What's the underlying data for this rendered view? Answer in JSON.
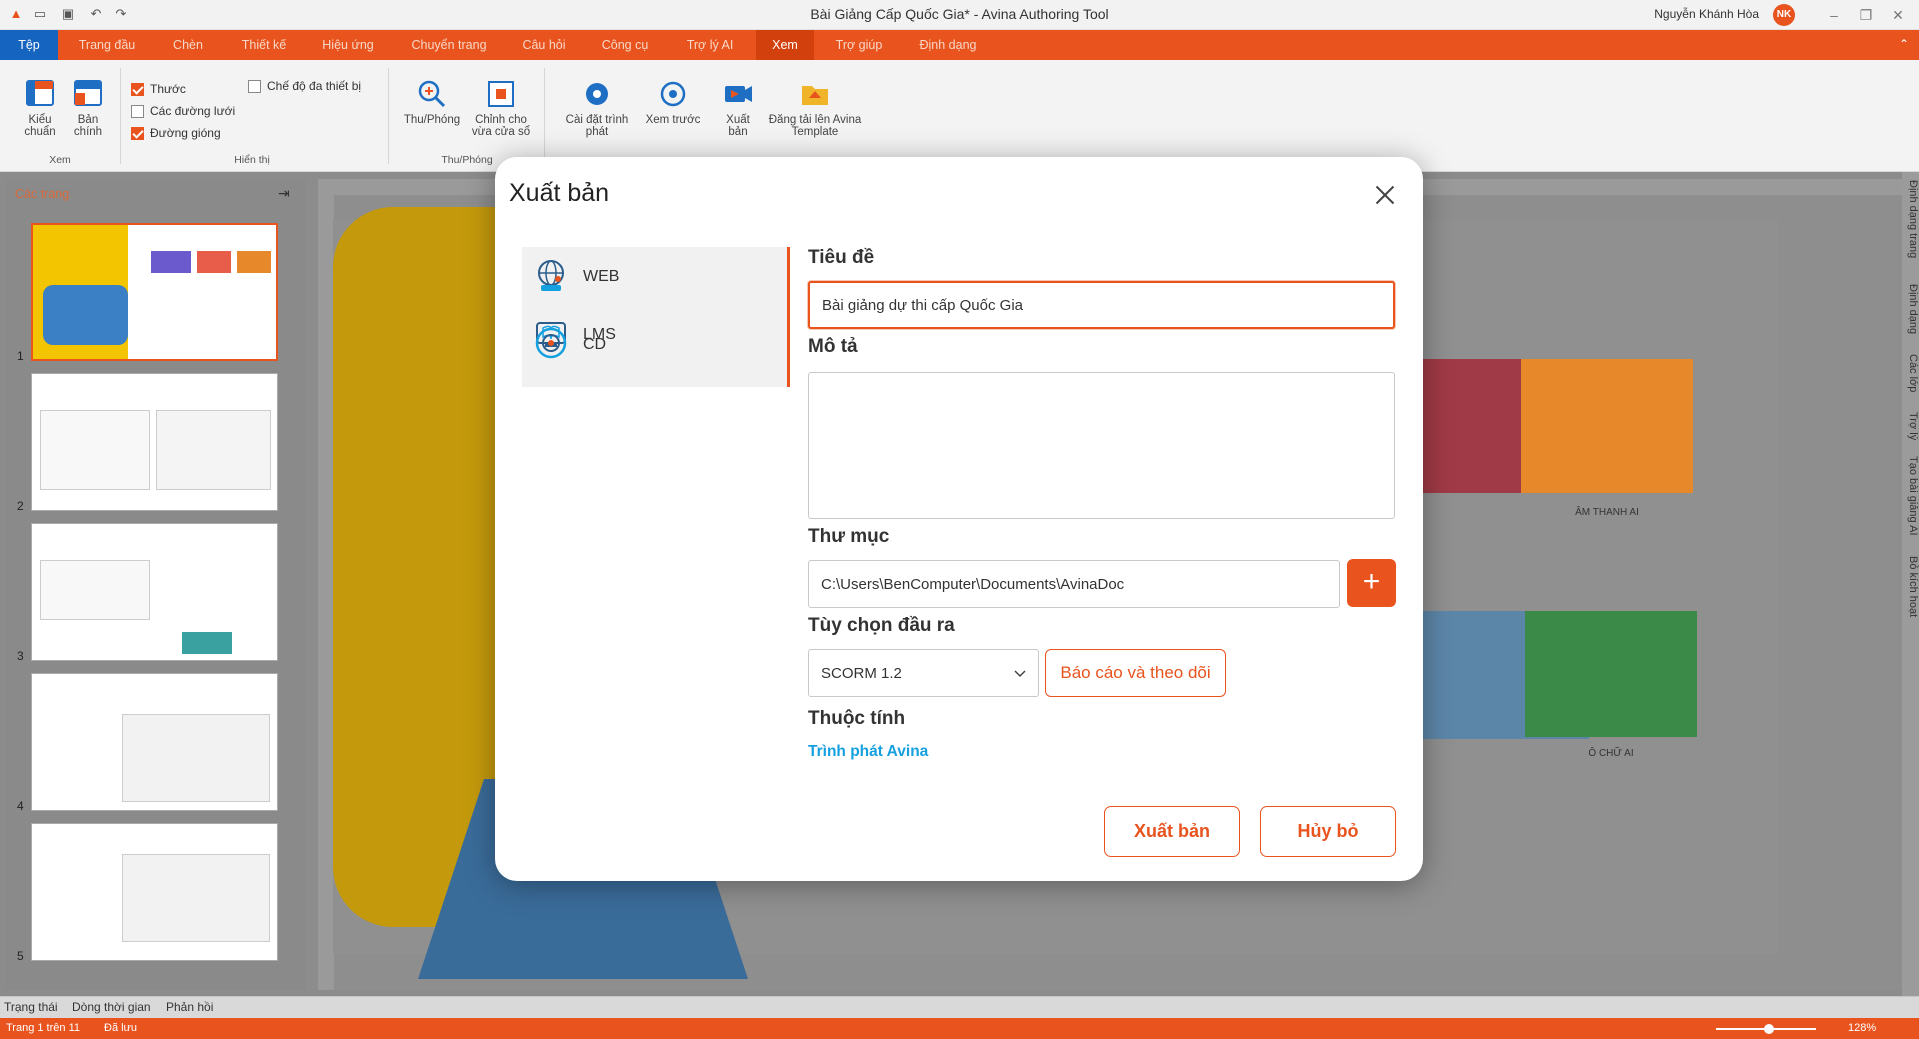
{
  "window": {
    "title": "Bài Giảng Cấp Quốc Gia* - Avina Authoring Tool",
    "user_name": "Nguyễn Khánh Hòa",
    "user_initials": "NK"
  },
  "menu": {
    "items": [
      "Tệp",
      "Trang đầu",
      "Chèn",
      "Thiết kế",
      "Hiệu ứng",
      "Chuyển trang",
      "Câu hỏi",
      "Công cụ",
      "Trợ lý AI",
      "Xem",
      "Trợ giúp",
      "Định dạng"
    ],
    "active": "Xem"
  },
  "ribbon": {
    "view_group": {
      "normal": "Kiểu chuẩn",
      "master": "Bản chính",
      "label": "Xem"
    },
    "show_group": {
      "ruler": "Thước",
      "grid": "Các đường lưới",
      "guides": "Đường gióng",
      "multi_device": "Chế độ đa thiết bị",
      "label": "Hiển thị",
      "ruler_checked": true,
      "grid_checked": false,
      "guides_checked": true,
      "multi_device_checked": false
    },
    "zoom_group": {
      "zoom": "Thu/Phóng",
      "fit": "Chỉnh cho vừa cửa sổ",
      "label": "Thu/Phóng"
    },
    "player_settings": "Cài đặt trình phát",
    "preview": "Xem trước",
    "publish": "Xuất bản",
    "upload_template": "Đăng tải lên Avina Template"
  },
  "pages_panel": {
    "title": "Các trang",
    "numbers": [
      "1",
      "2",
      "3",
      "4",
      "5"
    ]
  },
  "canvas": {
    "captions": [
      "ÂM THANH AI",
      "Ô CHỮ AI"
    ]
  },
  "dialog": {
    "title": "Xuất bản",
    "options": [
      {
        "label": "WEB",
        "icon": "globe-icon"
      },
      {
        "label": "LMS",
        "icon": "lms-icon"
      },
      {
        "label": "CD",
        "icon": "cd-icon"
      }
    ],
    "title_label": "Tiêu đề",
    "title_value": "Bài giảng dự thi cấp Quốc Gia",
    "desc_label": "Mô tả",
    "desc_value": "",
    "folder_label": "Thư mục",
    "folder_value": "C:\\Users\\BenComputer\\Documents\\AvinaDoc",
    "output_label": "Tùy chọn đầu ra",
    "output_value": "SCORM 1.2",
    "report_button": "Báo cáo và theo dõi",
    "properties_label": "Thuộc tính",
    "player_link": "Trình phát Avina",
    "publish_button": "Xuất bản",
    "cancel_button": "Hủy bỏ"
  },
  "bottom_tabs": [
    "Trạng thái",
    "Dòng thời gian",
    "Phản hồi"
  ],
  "status": {
    "page": "Trang 1 trên 11",
    "saved": "Đã lưu",
    "zoom": "128%"
  },
  "right_panel": [
    "Định dạng trang",
    "Định dạng",
    "Các lớp",
    "Trợ lý",
    "Tạo bài giảng AI",
    "Bỏ kích hoạt"
  ],
  "colors": {
    "accent": "#e8531e",
    "link": "#15a0e0",
    "file_tab": "#1565c0"
  }
}
